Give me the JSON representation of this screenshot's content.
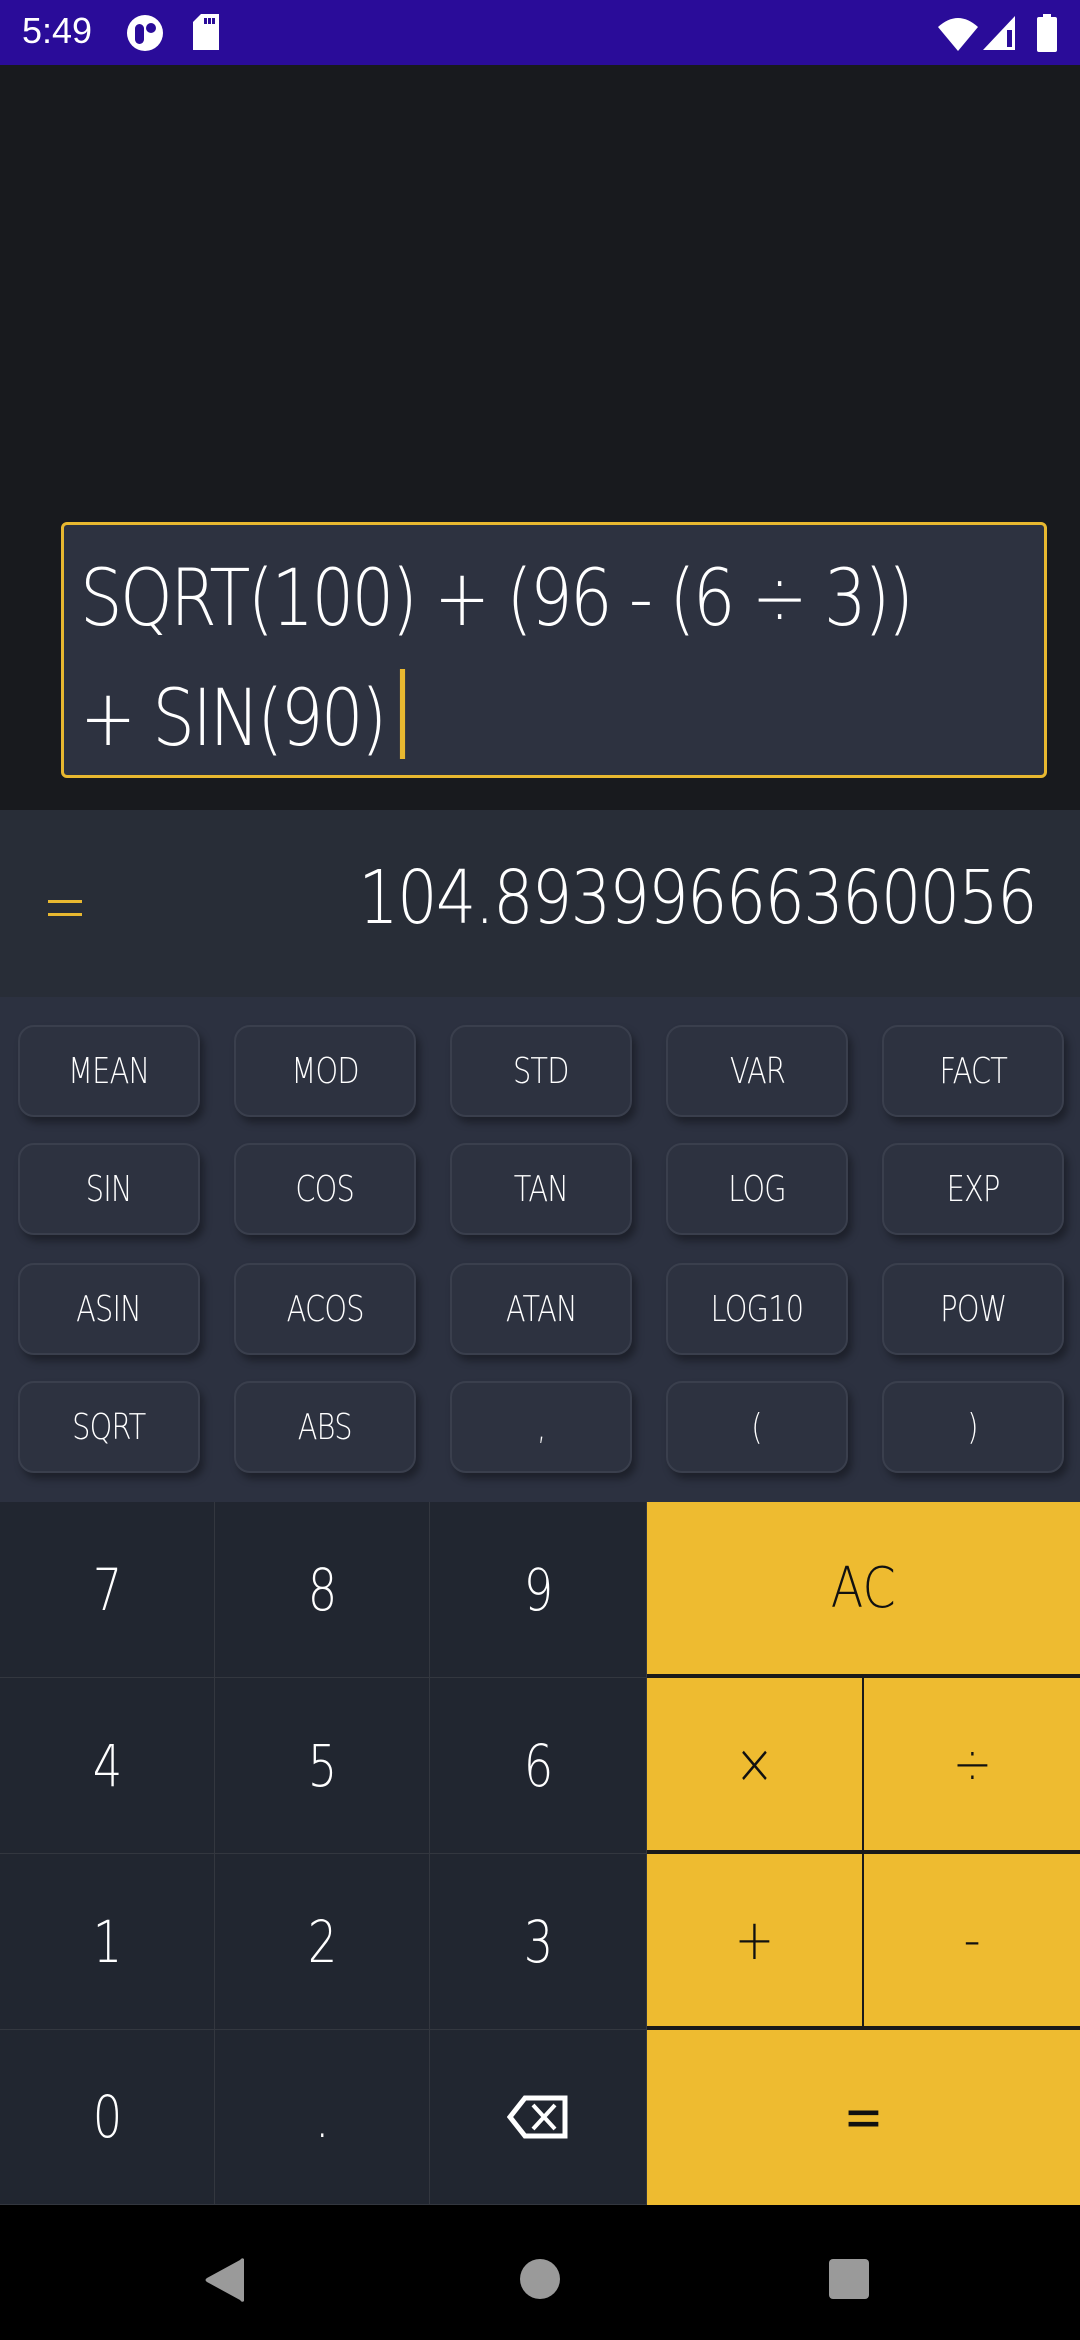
{
  "status_bar": {
    "time": "5:49",
    "left_icons": [
      "pocket-casts-icon",
      "sd-card-icon"
    ],
    "right_icons": [
      "wifi-icon",
      "cellular-signal-icon",
      "battery-icon"
    ]
  },
  "expression": {
    "line1": "SQRT(100) + (96 - (6 ÷ 3))",
    "line2": "+ SIN(90)"
  },
  "result": {
    "prefix_icon": "equals-icon",
    "value": "104.89399666360056"
  },
  "function_keys": [
    [
      "MEAN",
      "MOD",
      "STD",
      "VAR",
      "FACT"
    ],
    [
      "SIN",
      "COS",
      "TAN",
      "LOG",
      "EXP"
    ],
    [
      "ASIN",
      "ACOS",
      "ATAN",
      "LOG10",
      "POW"
    ],
    [
      "SQRT",
      "ABS",
      ",",
      "(",
      ")"
    ]
  ],
  "digit_keys": [
    [
      "7",
      "8",
      "9"
    ],
    [
      "4",
      "5",
      "6"
    ],
    [
      "1",
      "2",
      "3"
    ],
    [
      "0",
      ".",
      "backspace-icon"
    ]
  ],
  "operator_keys": {
    "clear": "AC",
    "multiply": "×",
    "divide": "÷",
    "add": "+",
    "subtract": "-",
    "equals": "="
  },
  "nav_bar": {
    "buttons": [
      "back-icon",
      "home-icon",
      "recents-icon"
    ]
  },
  "colors": {
    "accent": "#eebb30",
    "status_bar": "#2a0c99",
    "background": "#181a1e",
    "panel": "#2c3140",
    "keypad": "#212630"
  }
}
